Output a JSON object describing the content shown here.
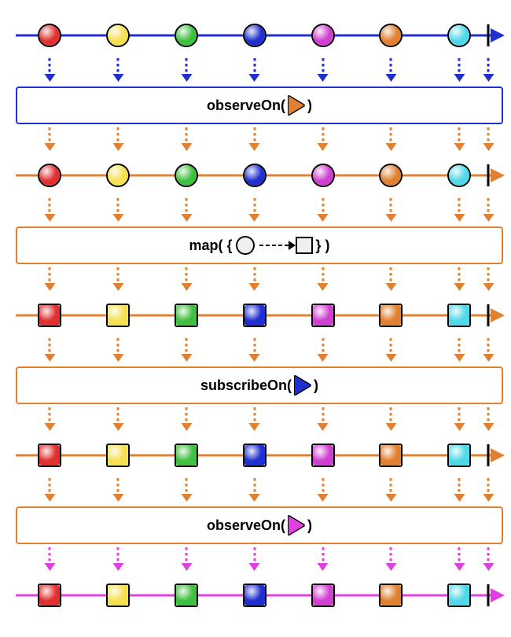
{
  "marbleColors": [
    "#e03030",
    "#f5e050",
    "#40c040",
    "#2030d0",
    "#d040d0",
    "#e08030",
    "#50d8e8"
  ],
  "marblePositions": [
    7,
    21,
    35,
    49,
    63,
    77,
    91
  ],
  "completePosition": 97,
  "schedulers": {
    "blue": "#2030d0",
    "orange": "#e08030",
    "magenta": "#e040e0"
  },
  "operators": {
    "observeOn1": {
      "label_pre": "observeOn(",
      "label_post": ")",
      "triColor": "#e08030",
      "borderColor": "#2030d0"
    },
    "map": {
      "label_pre": "map( {",
      "label_post": "} )",
      "borderColor": "#e08030"
    },
    "subscribeOn": {
      "label_pre": "subscribeOn(",
      "label_post": ")",
      "triColor": "#2030d0",
      "borderColor": "#e08030"
    },
    "observeOn2": {
      "label_pre": "observeOn(",
      "label_post": ")",
      "triColor": "#e040e0",
      "borderColor": "#e08030"
    }
  },
  "timelines": [
    {
      "color": "#2030d0",
      "shape": "circle"
    },
    {
      "color": "#e08030",
      "shape": "circle"
    },
    {
      "color": "#e08030",
      "shape": "square"
    },
    {
      "color": "#e08030",
      "shape": "square"
    },
    {
      "color": "#e040e0",
      "shape": "square"
    }
  ],
  "flowColors": [
    "#2030d0",
    "#e08030",
    "#e08030",
    "#e08030",
    "#e08030",
    "#e08030",
    "#e08030",
    "#e040e0"
  ]
}
